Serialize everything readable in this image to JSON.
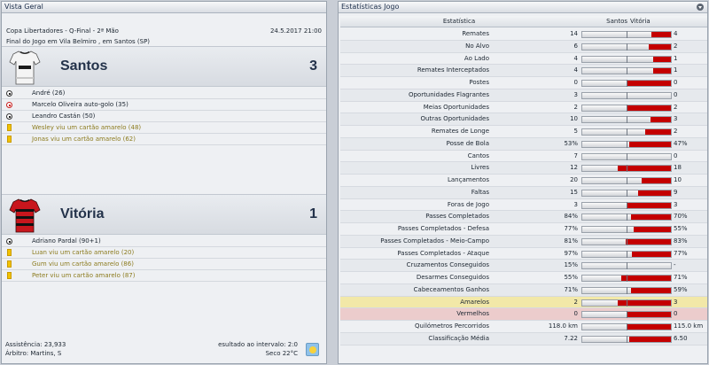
{
  "left_panel": {
    "title": "Vista Geral",
    "competition": "Copa Libertadores - Q-Final - 2ª Mão",
    "date": "24.5.2017 21:00",
    "venue": "Final do Jogo em Vila Belmiro , em Santos (SP)",
    "home": {
      "name": "Santos",
      "score": "3",
      "kit_colors": {
        "shirt": "#f4f4f4",
        "trim": "#1a1a1a"
      },
      "events": [
        {
          "type": "goal",
          "text": "André (26)"
        },
        {
          "type": "own-goal",
          "text": "Marcelo Oliveira auto-golo (35)"
        },
        {
          "type": "goal",
          "text": "Leandro Castán (50)"
        },
        {
          "type": "yellow",
          "text": "Wesley viu um cartão amarelo (48)"
        },
        {
          "type": "yellow",
          "text": "Jonas viu um cartão amarelo (62)"
        }
      ]
    },
    "away": {
      "name": "Vitória",
      "score": "1",
      "kit_colors": {
        "shirt": "#c8161d",
        "trim": "#111111"
      },
      "events": [
        {
          "type": "goal",
          "text": "Adriano Pardal (90+1)"
        },
        {
          "type": "yellow",
          "text": "Luan viu um cartão amarelo (20)"
        },
        {
          "type": "yellow",
          "text": "Gum viu um cartão amarelo (86)"
        },
        {
          "type": "yellow",
          "text": "Peter viu um cartão amarelo (87)"
        }
      ]
    },
    "footer": {
      "attendance": "Assistência: 23,933",
      "referee": "Árbitro: Martins, S",
      "halftime": "esultado ao intervalo: 2:0",
      "weather": "Seco 22°C",
      "weather_icon": "sun-icon"
    }
  },
  "right_panel": {
    "title": "Estatísticas Jogo",
    "header": {
      "stat": "Estatística",
      "home": "Santos",
      "away": "Vitória"
    },
    "colors": {
      "bar_fill": "#c40000",
      "yellow_row": "#f2e8a8",
      "red_row": "#eccccc"
    },
    "rows": [
      {
        "label": "Remates",
        "home": "14",
        "away": "4",
        "share": 0.222
      },
      {
        "label": "No Alvo",
        "home": "6",
        "away": "2",
        "share": 0.25
      },
      {
        "label": "Ao Lado",
        "home": "4",
        "away": "1",
        "share": 0.2
      },
      {
        "label": "Remates Interceptados",
        "home": "4",
        "away": "1",
        "share": 0.2
      },
      {
        "label": "Postes",
        "home": "0",
        "away": "0",
        "share": 0.5
      },
      {
        "label": "Oportunidades Flagrantes",
        "home": "3",
        "away": "0",
        "share": 0
      },
      {
        "label": "Meias Oportunidades",
        "home": "2",
        "away": "2",
        "share": 0.5
      },
      {
        "label": "Outras Oportunidades",
        "home": "10",
        "away": "3",
        "share": 0.23
      },
      {
        "label": "Remates de Longe",
        "home": "5",
        "away": "2",
        "share": 0.286
      },
      {
        "label": "Posse de Bola",
        "home": "53%",
        "away": "47%",
        "share": 0.47
      },
      {
        "label": "Cantos",
        "home": "7",
        "away": "0",
        "share": 0
      },
      {
        "label": "Livres",
        "home": "12",
        "away": "18",
        "share": 0.6
      },
      {
        "label": "Lançamentos",
        "home": "20",
        "away": "10",
        "share": 0.333
      },
      {
        "label": "Faltas",
        "home": "15",
        "away": "9",
        "share": 0.375
      },
      {
        "label": "Foras de Jogo",
        "home": "3",
        "away": "3",
        "share": 0.5
      },
      {
        "label": "Passes Completados",
        "home": "84%",
        "away": "70%",
        "share": 0.455
      },
      {
        "label": "Passes Completados - Defesa",
        "home": "77%",
        "away": "55%",
        "share": 0.417
      },
      {
        "label": "Passes Completados - Meio-Campo",
        "home": "81%",
        "away": "83%",
        "share": 0.506
      },
      {
        "label": "Passes Completados - Ataque",
        "home": "97%",
        "away": "77%",
        "share": 0.443
      },
      {
        "label": "Cruzamentos Conseguidos",
        "home": "15%",
        "away": "-",
        "share": 0
      },
      {
        "label": "Desarmes Conseguidos",
        "home": "55%",
        "away": "71%",
        "share": 0.563
      },
      {
        "label": "Cabeceamentos Ganhos",
        "home": "71%",
        "away": "59%",
        "share": 0.454
      },
      {
        "label": "Amarelos",
        "home": "2",
        "away": "3",
        "share": 0.6,
        "highlight": "yellow"
      },
      {
        "label": "Vermelhos",
        "home": "0",
        "away": "0",
        "share": 0.5,
        "highlight": "red"
      },
      {
        "label": "Quilómetros Percorridos",
        "home": "118.0 km",
        "away": "115.0 km",
        "share": 0.494
      },
      {
        "label": "Classificação Média",
        "home": "7.22",
        "away": "6.50",
        "share": 0.474
      }
    ]
  }
}
